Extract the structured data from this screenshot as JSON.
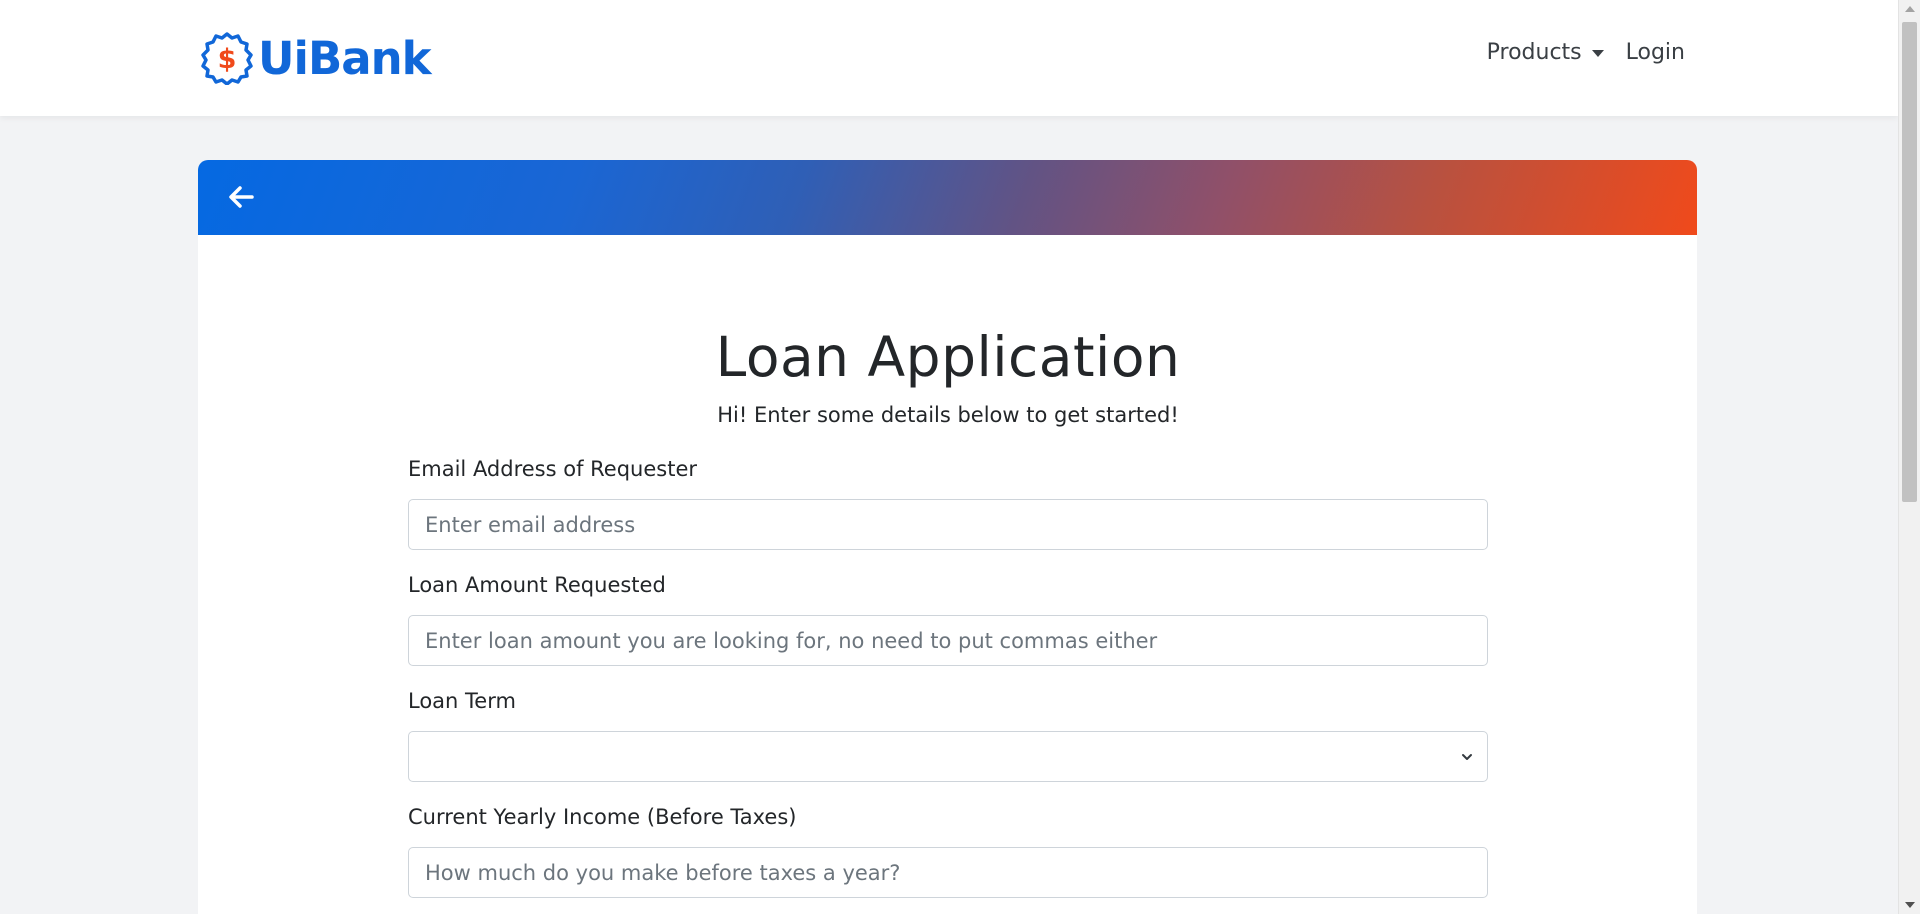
{
  "brand": {
    "name": "UiBank",
    "logo_icon": "dollar-badge-icon",
    "brand_color": "#1167d8",
    "accent_color": "#f04a1b"
  },
  "nav": {
    "products_label": "Products",
    "login_label": "Login"
  },
  "header": {
    "back_icon": "arrow-left-icon",
    "gradient_start": "#0569e2",
    "gradient_end": "#f04a1b"
  },
  "form": {
    "title": "Loan Application",
    "subtitle": "Hi! Enter some details below to get started!",
    "email": {
      "label": "Email Address of Requester",
      "placeholder": "Enter email address",
      "value": ""
    },
    "amount": {
      "label": "Loan Amount Requested",
      "placeholder": "Enter loan amount you are looking for, no need to put commas either",
      "value": ""
    },
    "term": {
      "label": "Loan Term",
      "selected": ""
    },
    "income": {
      "label": "Current Yearly Income (Before Taxes)",
      "placeholder": "How much do you make before taxes a year?",
      "value": ""
    }
  }
}
